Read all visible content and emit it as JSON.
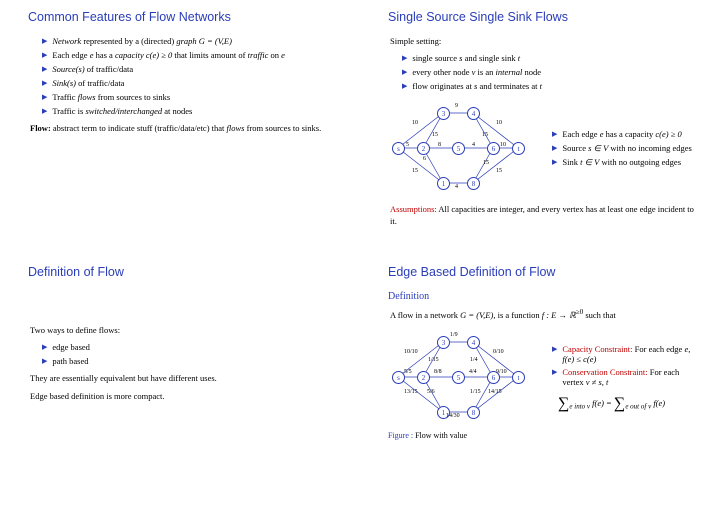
{
  "slide1": {
    "title": "Common Features of Flow Networks",
    "b1a": "Network",
    "b1b": " represented by a (directed) ",
    "b1c": "graph G = (V,E)",
    "b2a": "Each edge ",
    "b2b": "e",
    "b2c": " has a ",
    "b2d": "capacity c(e) ≥ 0",
    "b2e": " that limits amount of ",
    "b2f": "traffic",
    "b2g": " on ",
    "b2h": "e",
    "b3a": "Source(s)",
    "b3b": " of traffic/data",
    "b4a": "Sink(s)",
    "b4b": " of traffic/data",
    "b5a": "Traffic ",
    "b5b": "flows",
    "b5c": " from sources to sinks",
    "b6a": "Traffic is ",
    "b6b": "switched/interchanged",
    "b6c": " at nodes",
    "p1a": "Flow:",
    "p1b": " abstract term to indicate stuff (traffic/data/etc) that ",
    "p1c": "flows",
    "p1d": " from sources to sinks."
  },
  "slide2": {
    "title": "Single Source Single Sink Flows",
    "intro": "Simple setting:",
    "a1": "single source ",
    "a1b": "s",
    "a1c": " and single sink ",
    "a1d": "t",
    "a2": "every other node ",
    "a2b": "v",
    "a2c": " is an ",
    "a2d": "internal",
    "a2e": " node",
    "a3": "flow originates at ",
    "a3b": "s",
    "a3c": " and terminates at ",
    "a3d": "t",
    "c1": "Each edge ",
    "c1b": "e",
    "c1c": " has a capacity ",
    "c1d": "c(e) ≥ 0",
    "c2": "Source ",
    "c2b": "s ∈ V",
    "c2c": " with no incoming edges",
    "c3": "Sink ",
    "c3b": "t ∈ V",
    "c3c": " with no outgoing edges",
    "assa": "Assumptions:",
    "assb": " All capacities are integer, and every vertex has at least one edge incident to it.",
    "labels": {
      "n3": "3",
      "n4": "4",
      "ns": "s",
      "n2": "2",
      "n5": "5",
      "n6": "6",
      "nt": "t",
      "n1": "1",
      "n8": "8",
      "e9": "9",
      "e10l": "10",
      "e10r": "10",
      "e15l": "15",
      "e15r": "15",
      "e15b": "15",
      "e4l": "4",
      "e4b": "4",
      "e5": "5",
      "e6": "6",
      "e8": "8",
      "e10b": "10"
    }
  },
  "slide3": {
    "title": "Definition of Flow",
    "p1": "Two ways to define flows:",
    "b1": "edge based",
    "b2": "path based",
    "p2": "They are essentially equivalent but have different uses.",
    "p3": "Edge based definition is more compact."
  },
  "slide4": {
    "title": "Edge Based Definition of Flow",
    "def": "Definition",
    "d1a": "A flow in a network ",
    "d1b": "G = (V,E)",
    "d1c": ", is a function ",
    "d1d": "f : E → ℝ",
    "d1e": "≥0",
    "d1f": " such that",
    "r1a": "Capacity Constraint:",
    "r1b": " For each edge ",
    "r1c": "e",
    "r1d": ", ",
    "r1e": "f(e) ≤ c(e)",
    "r2a": "Conservation Constraint:",
    "r2b": " For each vertex ",
    "r2c": "v ≠ s, t",
    "eq1": "e into v",
    "eq2": "f(e)  =  ",
    "eq3": "e out of v",
    "eq4": "f(e)",
    "cap": "Figure : ",
    "capb": "Flow with value",
    "labels": {
      "n3": "3",
      "n4": "4",
      "ns": "s",
      "n2": "2",
      "n5": "5",
      "n6": "6",
      "nt": "t",
      "n1": "1",
      "n8": "8",
      "e1": "1/9",
      "e2": "10/10",
      "e3": "1/15",
      "e4": "1/4",
      "e5": "0/10",
      "e6": "5/5",
      "e7": "8/8",
      "e8": "4/4",
      "e9": "9/10",
      "e10": "13/15",
      "e11": "14/15",
      "e12": "5/6",
      "e13": "1/15",
      "e14": "14/30"
    }
  }
}
